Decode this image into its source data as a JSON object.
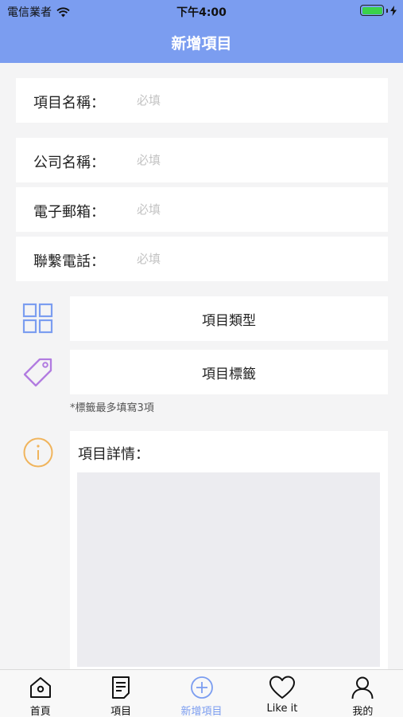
{
  "status_bar": {
    "carrier": "電信業者",
    "time": "下午4:00"
  },
  "nav": {
    "title": "新增項目"
  },
  "form": {
    "project_name": {
      "label": "項目名稱：",
      "placeholder": "必填"
    },
    "company_name": {
      "label": "公司名稱：",
      "placeholder": "必填"
    },
    "email": {
      "label": "電子郵箱：",
      "placeholder": "必填"
    },
    "phone": {
      "label": "聯繫電話：",
      "placeholder": "必填"
    }
  },
  "type_button": {
    "label": "項目類型"
  },
  "tag_button": {
    "label": "項目標籤"
  },
  "tag_hint": "*標籤最多填寫3項",
  "detail": {
    "title": "項目詳情："
  },
  "tabs": [
    {
      "label": "首頁"
    },
    {
      "label": "項目"
    },
    {
      "label": "新增項目"
    },
    {
      "label": "Like it"
    },
    {
      "label": "我的"
    }
  ],
  "colors": {
    "accent": "#7b9df0",
    "grid_icon": "#7b9df0",
    "tag_icon": "#b17be0",
    "info_icon": "#f0b45c",
    "battery": "#3bd24a"
  }
}
